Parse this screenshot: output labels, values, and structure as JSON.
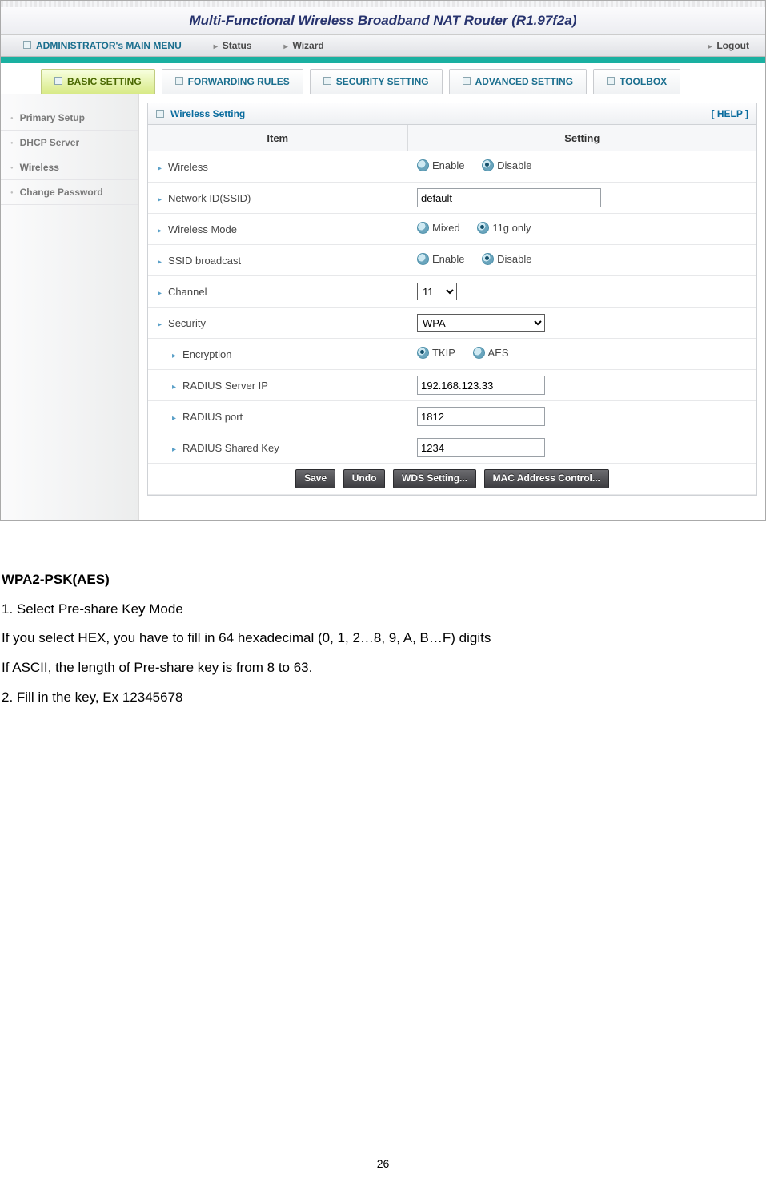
{
  "header": {
    "product_title": "Multi-Functional Wireless Broadband NAT Router (R1.97f2a)",
    "admin_label": "ADMINISTRATOR's MAIN MENU",
    "menu_status": "Status",
    "menu_wizard": "Wizard",
    "menu_logout": "Logout"
  },
  "tabs": {
    "basic": "BASIC SETTING",
    "forwarding": "FORWARDING RULES",
    "security": "SECURITY SETTING",
    "advanced": "ADVANCED SETTING",
    "toolbox": "TOOLBOX"
  },
  "sidebar": {
    "primary": "Primary Setup",
    "dhcp": "DHCP Server",
    "wireless": "Wireless",
    "changepw": "Change Password"
  },
  "panel": {
    "title": "Wireless Setting",
    "help": "[ HELP ]",
    "col_item": "Item",
    "col_setting": "Setting",
    "rows": {
      "wireless": "Wireless",
      "ssid": "Network ID(SSID)",
      "mode": "Wireless Mode",
      "broadcast": "SSID broadcast",
      "channel": "Channel",
      "security": "Security",
      "encryption": "Encryption",
      "radius_ip": "RADIUS Server IP",
      "radius_port": "RADIUS port",
      "radius_key": "RADIUS Shared Key"
    },
    "options": {
      "enable": "Enable",
      "disable": "Disable",
      "mixed": "Mixed",
      "g_only": "11g only",
      "tkip": "TKIP",
      "aes": "AES"
    },
    "values": {
      "ssid": "default",
      "channel": "11",
      "security": "WPA",
      "radius_ip": "192.168.123.33",
      "radius_port": "1812",
      "radius_key": "1234"
    },
    "buttons": {
      "save": "Save",
      "undo": "Undo",
      "wds": "WDS Setting...",
      "mac": "MAC Address Control..."
    }
  },
  "doc": {
    "h1": "WPA2-PSK(AES)",
    "p1": "1. Select Pre-share Key Mode",
    "p2": "If you select HEX, you have to fill in 64 hexadecimal (0, 1, 2…8, 9, A, B…F) digits",
    "p3": "If ASCII, the length of Pre-share key is from 8 to 63.",
    "p4": "2. Fill in the key, Ex 12345678"
  },
  "page_number": "26"
}
